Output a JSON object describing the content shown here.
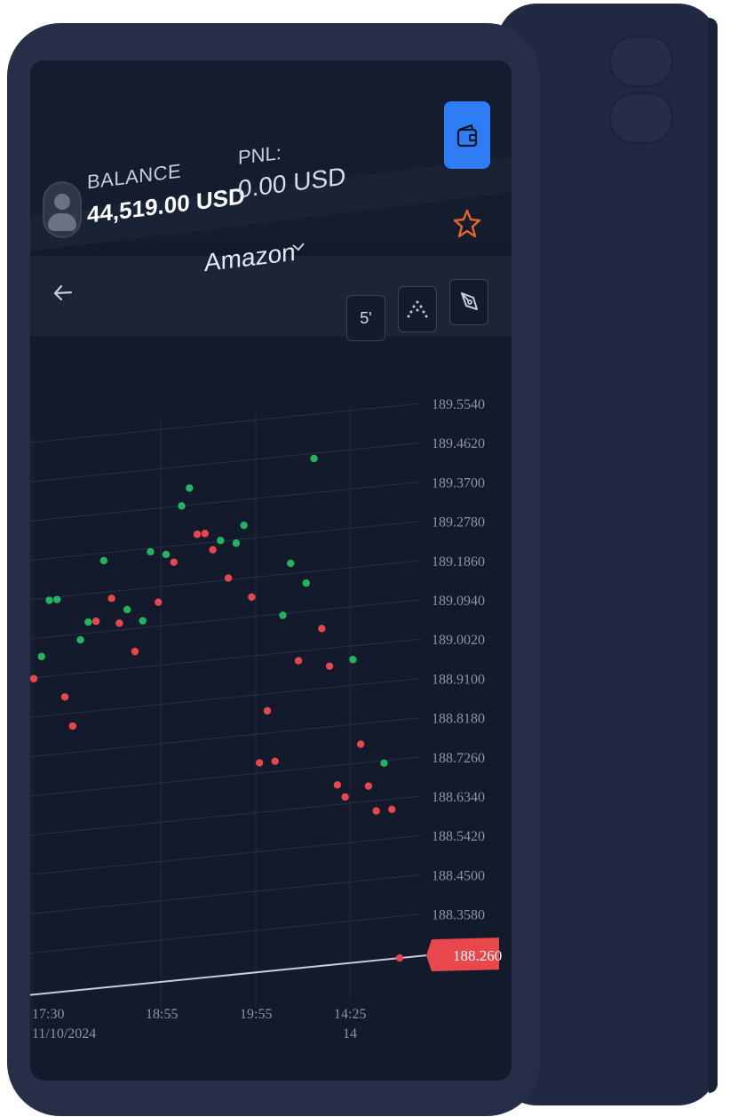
{
  "header": {
    "balance_label": "BALANCE",
    "balance_value": "44,519.00 USD",
    "pnl_label": "PNL:",
    "pnl_value": "0.00 USD",
    "wallet_icon": "wallet-icon",
    "favorite_icon": "star-icon"
  },
  "asset": {
    "name": "Amazon",
    "dropdown_icon": "chevron-down-icon",
    "back_icon": "arrow-left-icon"
  },
  "toolbar": {
    "timeframe_label": "5'",
    "indicator_icon": "scatter-dots-icon",
    "draw_icon": "pen-tool-icon"
  },
  "colors": {
    "accent": "#2f7df6",
    "up": "#22b55e",
    "down": "#e8474b",
    "star": "#e0662b",
    "background": "#121a2c"
  },
  "chart_data": {
    "type": "scatter",
    "y_ticks": [
      "189.5540",
      "189.4620",
      "189.3700",
      "189.2780",
      "189.1860",
      "189.0940",
      "189.0020",
      "188.9100",
      "188.8180",
      "188.7260",
      "188.6340",
      "188.5420",
      "188.4500",
      "188.3580"
    ],
    "x_ticks": [
      {
        "time": "17:30",
        "date": "11/10/2024"
      },
      {
        "time": "18:55",
        "date": ""
      },
      {
        "time": "19:55",
        "date": ""
      },
      {
        "time": "14:25",
        "date": "14"
      }
    ],
    "current_price": "188.260",
    "points": [
      {
        "i": 0,
        "y": 189.0,
        "dir": "down"
      },
      {
        "i": 1,
        "y": 189.05,
        "dir": "up"
      },
      {
        "i": 2,
        "y": 189.18,
        "dir": "up"
      },
      {
        "i": 3,
        "y": 189.18,
        "dir": "up"
      },
      {
        "i": 4,
        "y": 188.95,
        "dir": "down"
      },
      {
        "i": 5,
        "y": 188.88,
        "dir": "down"
      },
      {
        "i": 6,
        "y": 189.08,
        "dir": "up"
      },
      {
        "i": 7,
        "y": 189.12,
        "dir": "up"
      },
      {
        "i": 8,
        "y": 189.12,
        "dir": "down"
      },
      {
        "i": 9,
        "y": 189.26,
        "dir": "up"
      },
      {
        "i": 10,
        "y": 189.17,
        "dir": "down"
      },
      {
        "i": 11,
        "y": 189.11,
        "dir": "down"
      },
      {
        "i": 12,
        "y": 189.14,
        "dir": "up"
      },
      {
        "i": 13,
        "y": 189.04,
        "dir": "down"
      },
      {
        "i": 14,
        "y": 189.11,
        "dir": "up"
      },
      {
        "i": 15,
        "y": 189.27,
        "dir": "up"
      },
      {
        "i": 16,
        "y": 189.15,
        "dir": "down"
      },
      {
        "i": 17,
        "y": 189.26,
        "dir": "up"
      },
      {
        "i": 18,
        "y": 189.24,
        "dir": "down"
      },
      {
        "i": 19,
        "y": 189.37,
        "dir": "up"
      },
      {
        "i": 20,
        "y": 189.41,
        "dir": "up"
      },
      {
        "i": 21,
        "y": 189.3,
        "dir": "down"
      },
      {
        "i": 22,
        "y": 189.3,
        "dir": "down"
      },
      {
        "i": 23,
        "y": 189.26,
        "dir": "down"
      },
      {
        "i": 24,
        "y": 189.28,
        "dir": "up"
      },
      {
        "i": 25,
        "y": 189.19,
        "dir": "down"
      },
      {
        "i": 26,
        "y": 189.27,
        "dir": "up"
      },
      {
        "i": 27,
        "y": 189.31,
        "dir": "up"
      },
      {
        "i": 28,
        "y": 189.14,
        "dir": "down"
      },
      {
        "i": 29,
        "y": 188.75,
        "dir": "down"
      },
      {
        "i": 30,
        "y": 188.87,
        "dir": "down"
      },
      {
        "i": 31,
        "y": 188.75,
        "dir": "down"
      },
      {
        "i": 32,
        "y": 189.09,
        "dir": "up"
      },
      {
        "i": 33,
        "y": 189.21,
        "dir": "up"
      },
      {
        "i": 34,
        "y": 188.98,
        "dir": "down"
      },
      {
        "i": 35,
        "y": 189.16,
        "dir": "up"
      },
      {
        "i": 36,
        "y": 189.45,
        "dir": "up"
      },
      {
        "i": 37,
        "y": 189.05,
        "dir": "down"
      },
      {
        "i": 38,
        "y": 188.96,
        "dir": "down"
      },
      {
        "i": 39,
        "y": 188.68,
        "dir": "down"
      },
      {
        "i": 40,
        "y": 188.65,
        "dir": "down"
      },
      {
        "i": 41,
        "y": 188.97,
        "dir": "up"
      },
      {
        "i": 42,
        "y": 188.77,
        "dir": "down"
      },
      {
        "i": 43,
        "y": 188.67,
        "dir": "down"
      },
      {
        "i": 44,
        "y": 188.61,
        "dir": "down"
      },
      {
        "i": 45,
        "y": 188.72,
        "dir": "up"
      },
      {
        "i": 46,
        "y": 188.61,
        "dir": "down"
      },
      {
        "i": 47,
        "y": 188.26,
        "dir": "down"
      }
    ]
  }
}
